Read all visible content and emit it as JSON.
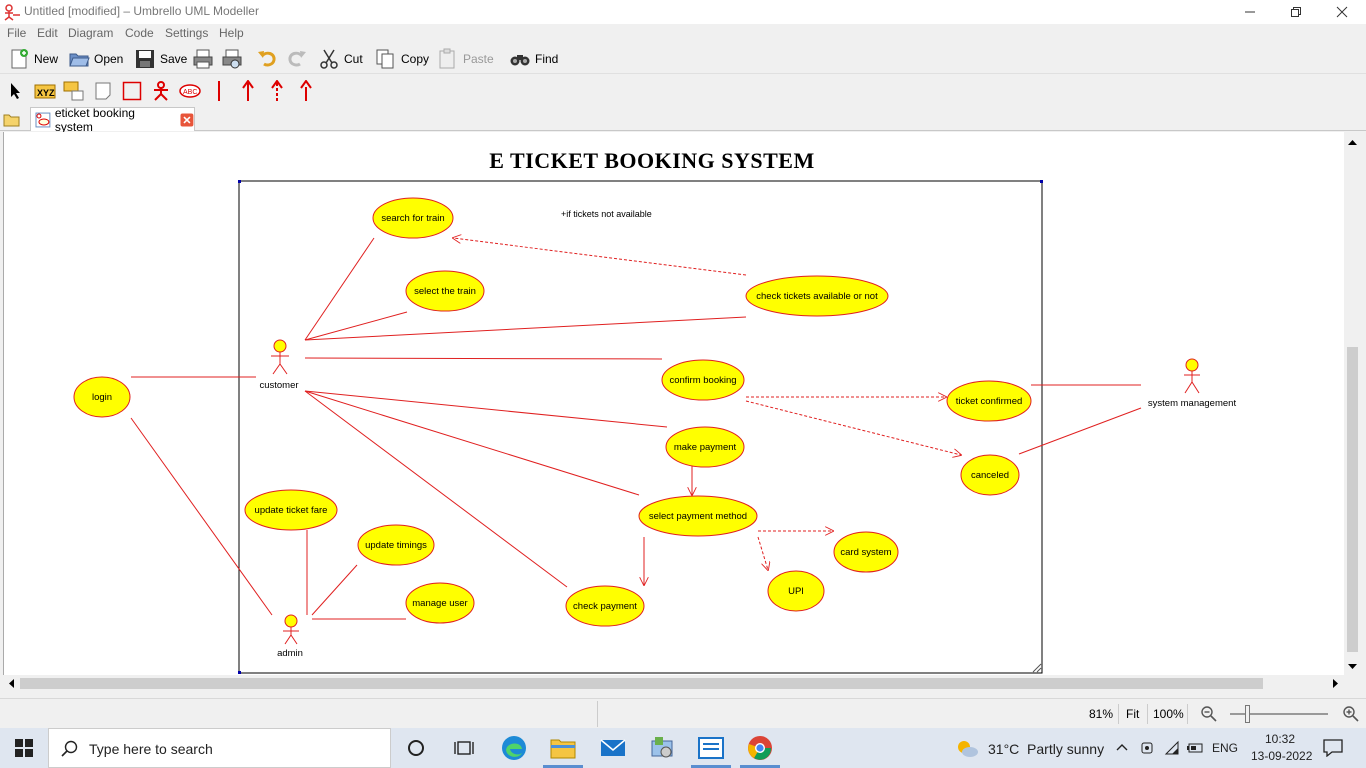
{
  "window": {
    "title": "Untitled [modified] – Umbrello UML Modeller",
    "minimize_icon": "minimize-icon",
    "restore_icon": "restore-icon",
    "close_icon": "close-icon"
  },
  "menu": {
    "items": [
      "File",
      "Edit",
      "Diagram",
      "Code",
      "Settings",
      "Help"
    ]
  },
  "toolbar": {
    "new": "New",
    "open": "Open",
    "save": "Save",
    "cut": "Cut",
    "copy": "Copy",
    "paste": "Paste",
    "find": "Find"
  },
  "tab": {
    "label": "eticket booking system"
  },
  "diagram": {
    "title": "E TICKET BOOKING SYSTEM",
    "note": "+if tickets not available",
    "actors": {
      "customer": "customer",
      "admin": "admin",
      "system_management": "system management"
    },
    "usecases": {
      "search_train": "search for train",
      "select_train": "select the train",
      "check_tickets": "check tickets available or not",
      "confirm_booking": "confirm booking",
      "ticket_confirmed": "ticket confirmed",
      "canceled": "canceled",
      "make_payment": "make payment",
      "select_payment_method": "select payment method",
      "card_system": "card system",
      "upi": "UPI",
      "check_payment": "check payment",
      "login": "login",
      "update_ticket_fare": "update ticket fare",
      "update_timings": "update timings",
      "manage_user": "manage user"
    },
    "colors": {
      "usecase_fill": "#ffff00",
      "line": "#e02020",
      "boundary": "#000000"
    }
  },
  "status": {
    "zoom": "81%",
    "fit": "Fit",
    "hundred": "100%"
  },
  "taskbar": {
    "search_placeholder": "Type here to search",
    "weather": "31°C  Partly sunny",
    "lang": "ENG",
    "time": "10:32",
    "date": "13-09-2022"
  }
}
